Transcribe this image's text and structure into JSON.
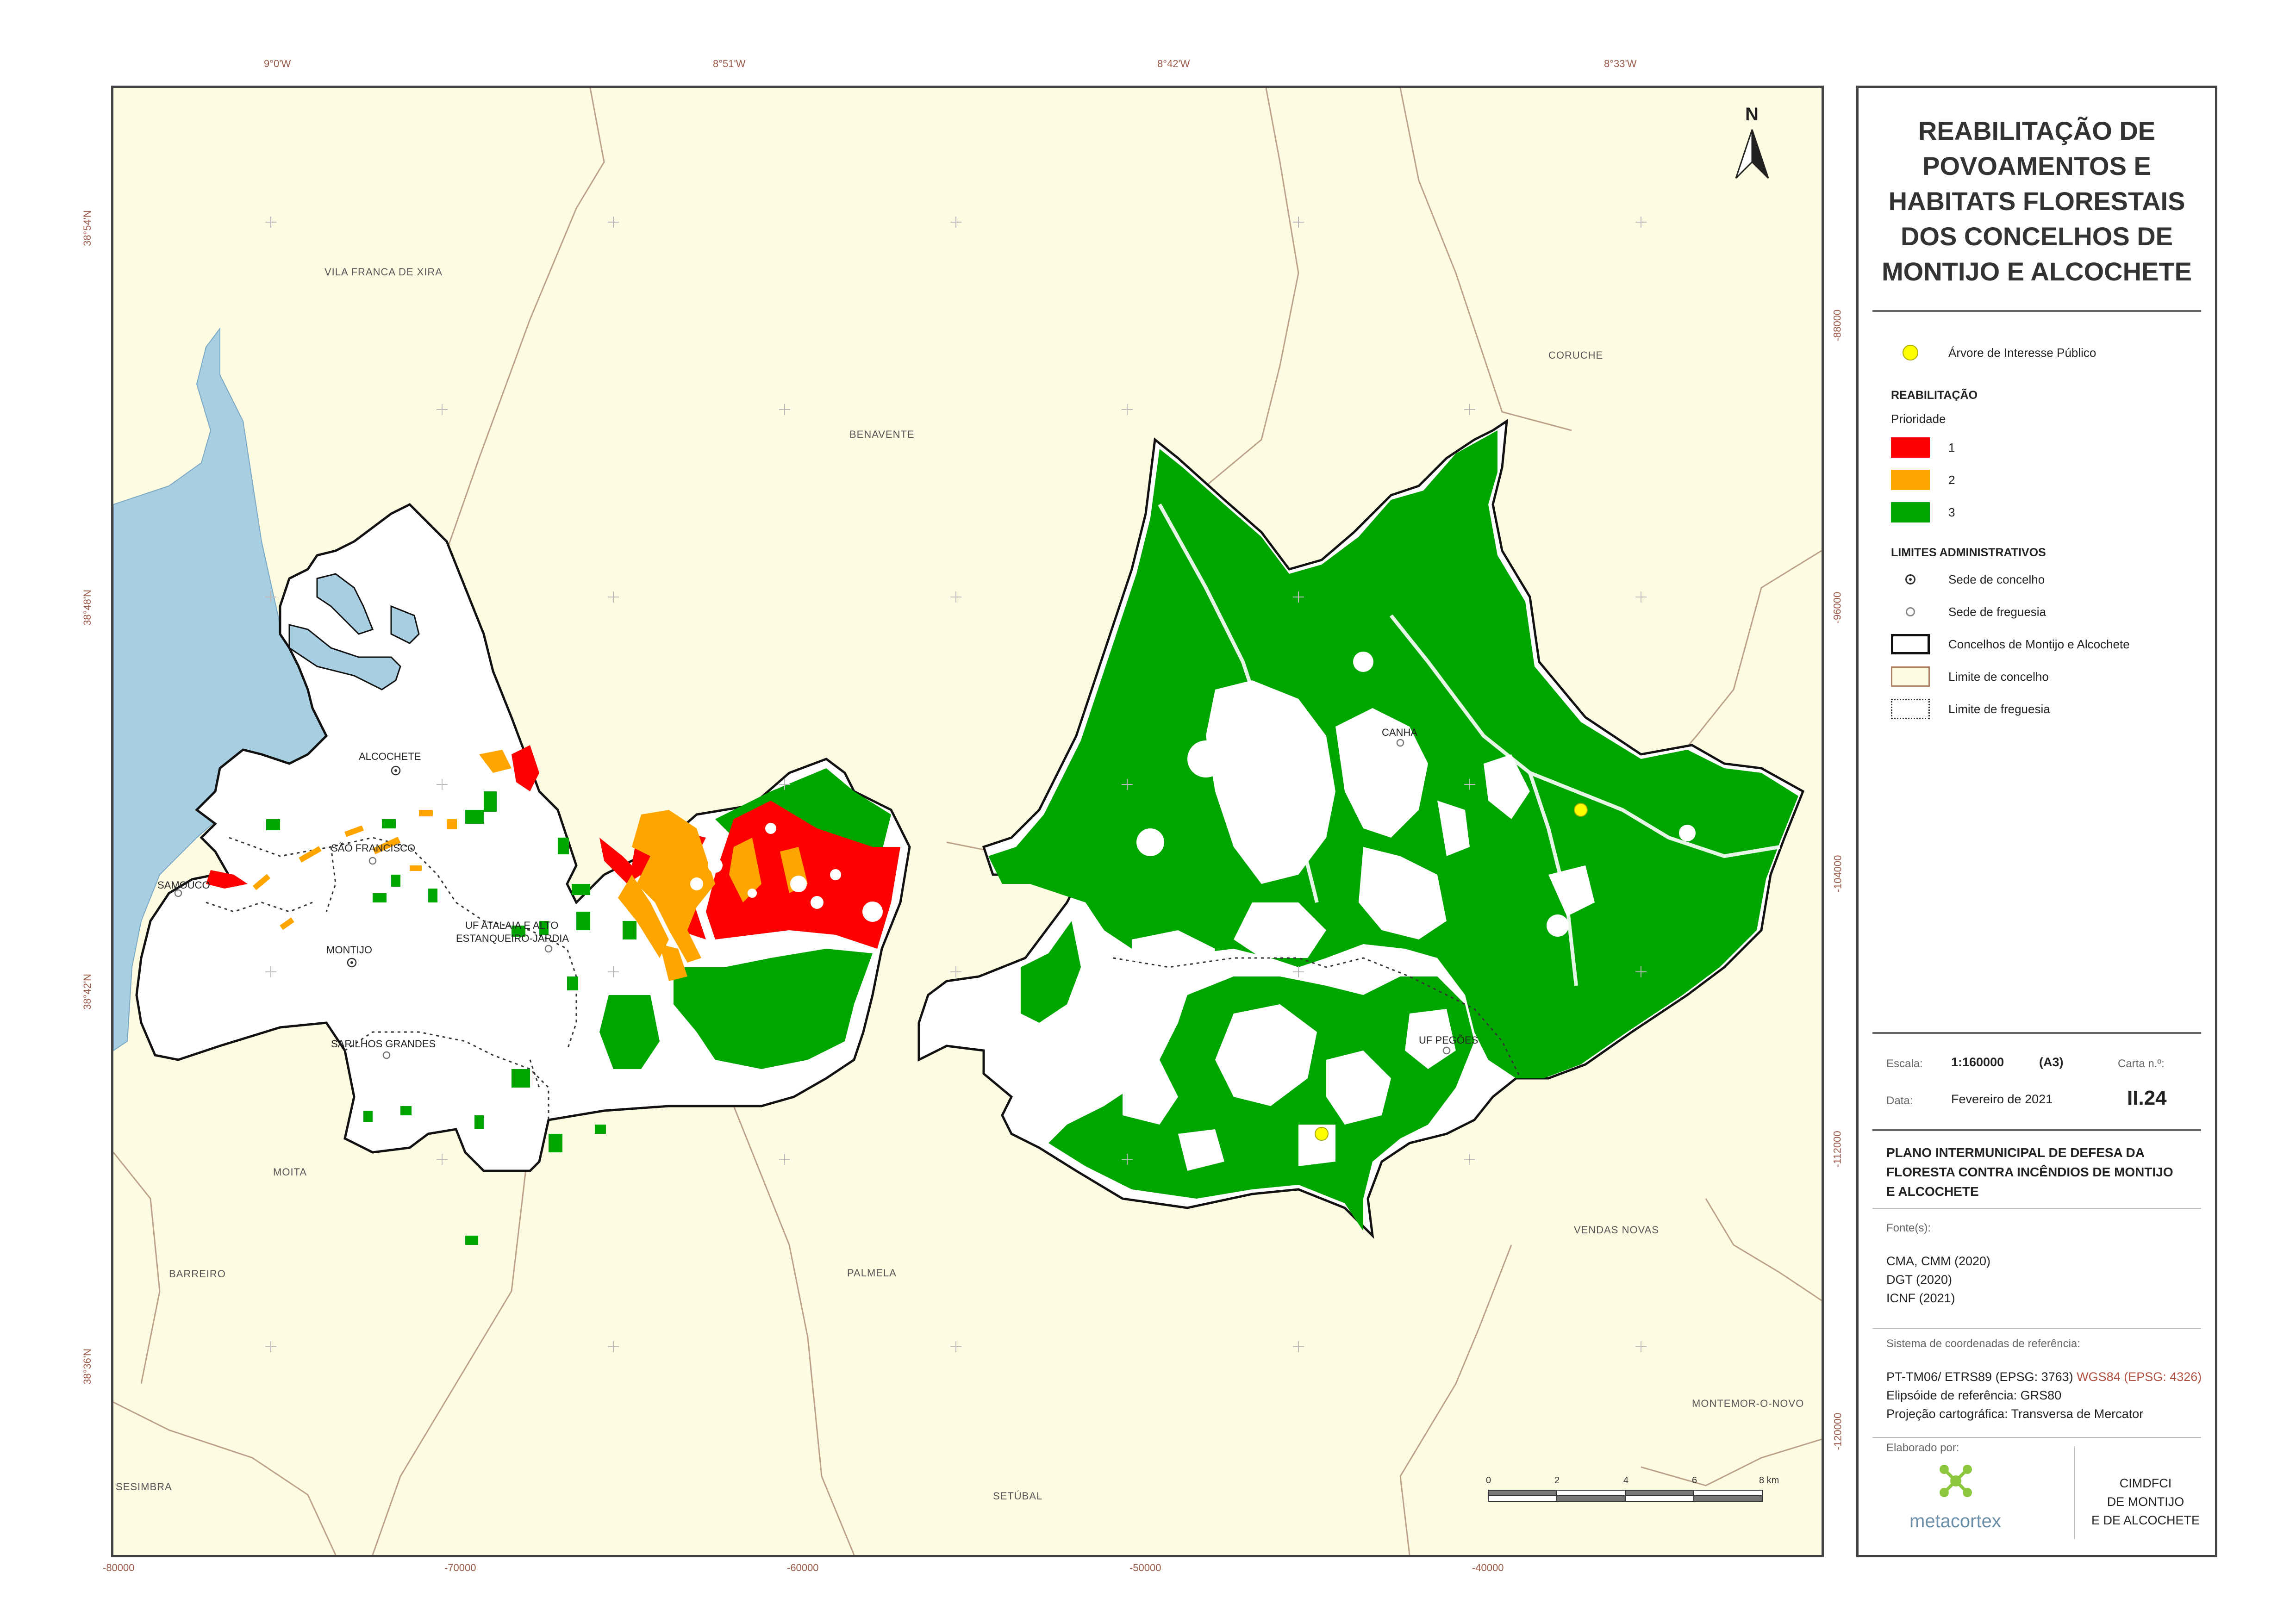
{
  "title": "REABILITAÇÃO DE POVOAMENTOS E HABITATS FLORESTAIS DOS CONCELHOS DE MONTIJO E ALCOCHETE",
  "north_arrow": "N",
  "top_coords": [
    "9°0'W",
    "8°51'W",
    "8°42'W",
    "8°33'W"
  ],
  "left_coords": [
    "38°54'N",
    "38°48'N",
    "38°42'N",
    "38°36'N"
  ],
  "bottom_coords": [
    "-80000",
    "-70000",
    "-60000",
    "-50000",
    "-40000"
  ],
  "right_coords": [
    "-88000",
    "-96000",
    "-104000",
    "-112000",
    "-120000"
  ],
  "place_labels": {
    "vila_franca": "VILA FRANCA DE XIRA",
    "benavente": "BENAVENTE",
    "coruche": "CORUCHE",
    "alcochete": "ALCOCHETE",
    "sao_francisco": "SÃO FRANCISCO",
    "samouco": "SAMOUCO",
    "montijo": "MONTIJO",
    "atalaia_1": "UF ATALAIA E ALTO",
    "atalaia_2": "ESTANQUEIRO-JARDIA",
    "sarilhos": "SARILHOS GRANDES",
    "canha": "CANHA",
    "pegoes": "UF PEGÕES",
    "moita": "MOITA",
    "barreiro": "BARREIRO",
    "palmela": "PALMELA",
    "vendas_novas": "VENDAS NOVAS",
    "montemor": "MONTEMOR-O-NOVO",
    "sesimbra": "SESIMBRA",
    "setubal": "SETÚBAL"
  },
  "scalebar": {
    "ticks": [
      "0",
      "2",
      "4",
      "6",
      "8 km"
    ]
  },
  "legend": {
    "arvore": "Árvore de Interesse Público",
    "reab_head": "REABILITAÇÃO",
    "prioridade": "Prioridade",
    "p1": "1",
    "p2": "2",
    "p3": "3",
    "limites_head": "LIMITES ADMINISTRATIVOS",
    "sede_concelho": "Sede de concelho",
    "sede_freguesia": "Sede de freguesia",
    "concelhos": "Concelhos de Montijo e Alcochete",
    "limite_concelho": "Limite de concelho",
    "limite_freguesia": "Limite de freguesia",
    "colors": {
      "p1": "#ff0000",
      "p2": "#ffa500",
      "p3": "#00a600",
      "tree": "#ffff00",
      "water": "#a8cee2",
      "land": "#fdfce3"
    }
  },
  "info": {
    "escala_label": "Escala:",
    "escala_value": "1:160000",
    "formato": "(A3)",
    "carta_label": "Carta n.º:",
    "data_label": "Data:",
    "data_value": "Fevereiro de 2021",
    "carta_value": "II.24",
    "plano": "PLANO INTERMUNICIPAL DE DEFESA DA FLORESTA CONTRA INCÊNDIOS DE MONTIJO E ALCOCHETE",
    "fontes_label": "Fonte(s):",
    "fontes": [
      "CMA, CMM (2020)",
      "DGT (2020)",
      "ICNF (2021)"
    ],
    "sistema_label": "Sistema de coordenadas de referência:",
    "sistema_a": "PT-TM06/ ETRS89 (EPSG: 3763)",
    "sistema_b": "WGS84 (EPSG: 4326)",
    "elipsoide": "Elipsóide de referência: GRS80",
    "projecao": "Projeção cartográfica: Transversa de Mercator",
    "elaborado_label": "Elaborado por:",
    "logo_text": "metacortex",
    "org": [
      "CIMDFCI",
      "DE MONTIJO",
      "E DE ALCOCHETE"
    ]
  }
}
